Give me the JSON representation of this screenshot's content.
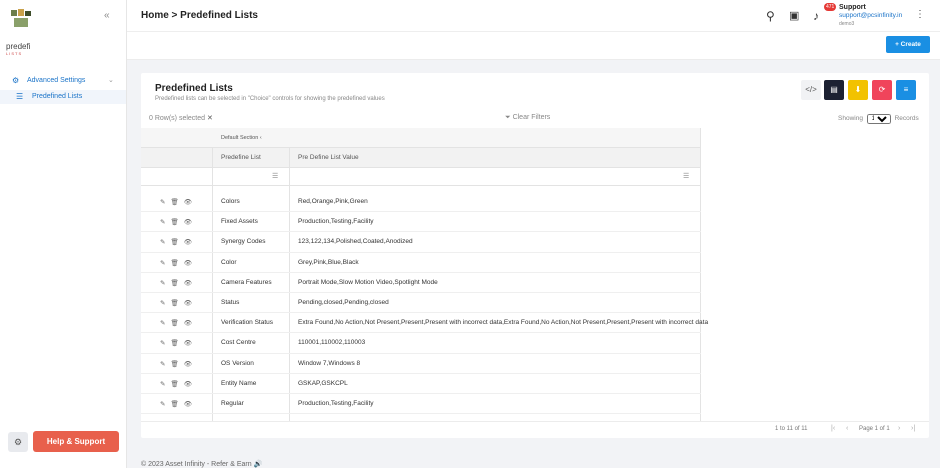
{
  "sidebar": {
    "logo_text": "predefi",
    "logo_sub": "LISTS",
    "group_label": "Advanced Settings",
    "active_item": "Predefined Lists",
    "help_label": "Help & Support"
  },
  "topbar": {
    "breadcrumb": "Home > Predefined Lists",
    "notification_count": "471",
    "user_name": "Support",
    "user_email": "support@pcsinfinity.in",
    "user_org": "demo3"
  },
  "subbar": {
    "create_label": "+ Create"
  },
  "card": {
    "title": "Predefined Lists",
    "subtitle": "Predefined lists can be selected in \"Choice\" controls for showing the predefined values",
    "rows_selected": "0 Row(s) selected",
    "clear_filters": "Clear Filters",
    "showing_label": "Showing",
    "records_label": "Records",
    "page_size": "100",
    "section_label": "Default Section",
    "col_list": "Predefine List",
    "col_value": "Pre Define List Value",
    "action_colors": {
      "code": "#f1f2f4",
      "doc": "#1c2132",
      "download": "#f2c200",
      "refresh": "#f0445b",
      "list": "#1a8fe3"
    },
    "pager_info": "1 to 11 of 11",
    "pager_page": "Page 1 of 1"
  },
  "rows": [
    {
      "name": "Colors",
      "value": "Red,Orange,Pink,Green"
    },
    {
      "name": "Fixed Assets",
      "value": "Production,Testing,Facility"
    },
    {
      "name": "Synergy Codes",
      "value": "123,122,134,Polished,Coated,Anodized"
    },
    {
      "name": "Color",
      "value": "Grey,Pink,Blue,Black"
    },
    {
      "name": "Camera Features",
      "value": "Portrait Mode,Slow Motion Video,Spotlight Mode"
    },
    {
      "name": "Status",
      "value": "Pending,closed,Pending,closed"
    },
    {
      "name": "Verification Status",
      "value": "Extra Found,No Action,Not Present,Present,Present with incorrect data,Extra Found,No Action,Not Present,Present,Present with incorrect data"
    },
    {
      "name": "Cost Centre",
      "value": "110001,110002,110003"
    },
    {
      "name": "OS Version",
      "value": "Window 7,Windows 8"
    },
    {
      "name": "Entity Name",
      "value": "GSKAP,GSKCPL"
    },
    {
      "name": "Regular",
      "value": "Production,Testing,Facility"
    }
  ],
  "footer": {
    "text": "© 2023  Asset Infinity - Refer & Earn"
  }
}
